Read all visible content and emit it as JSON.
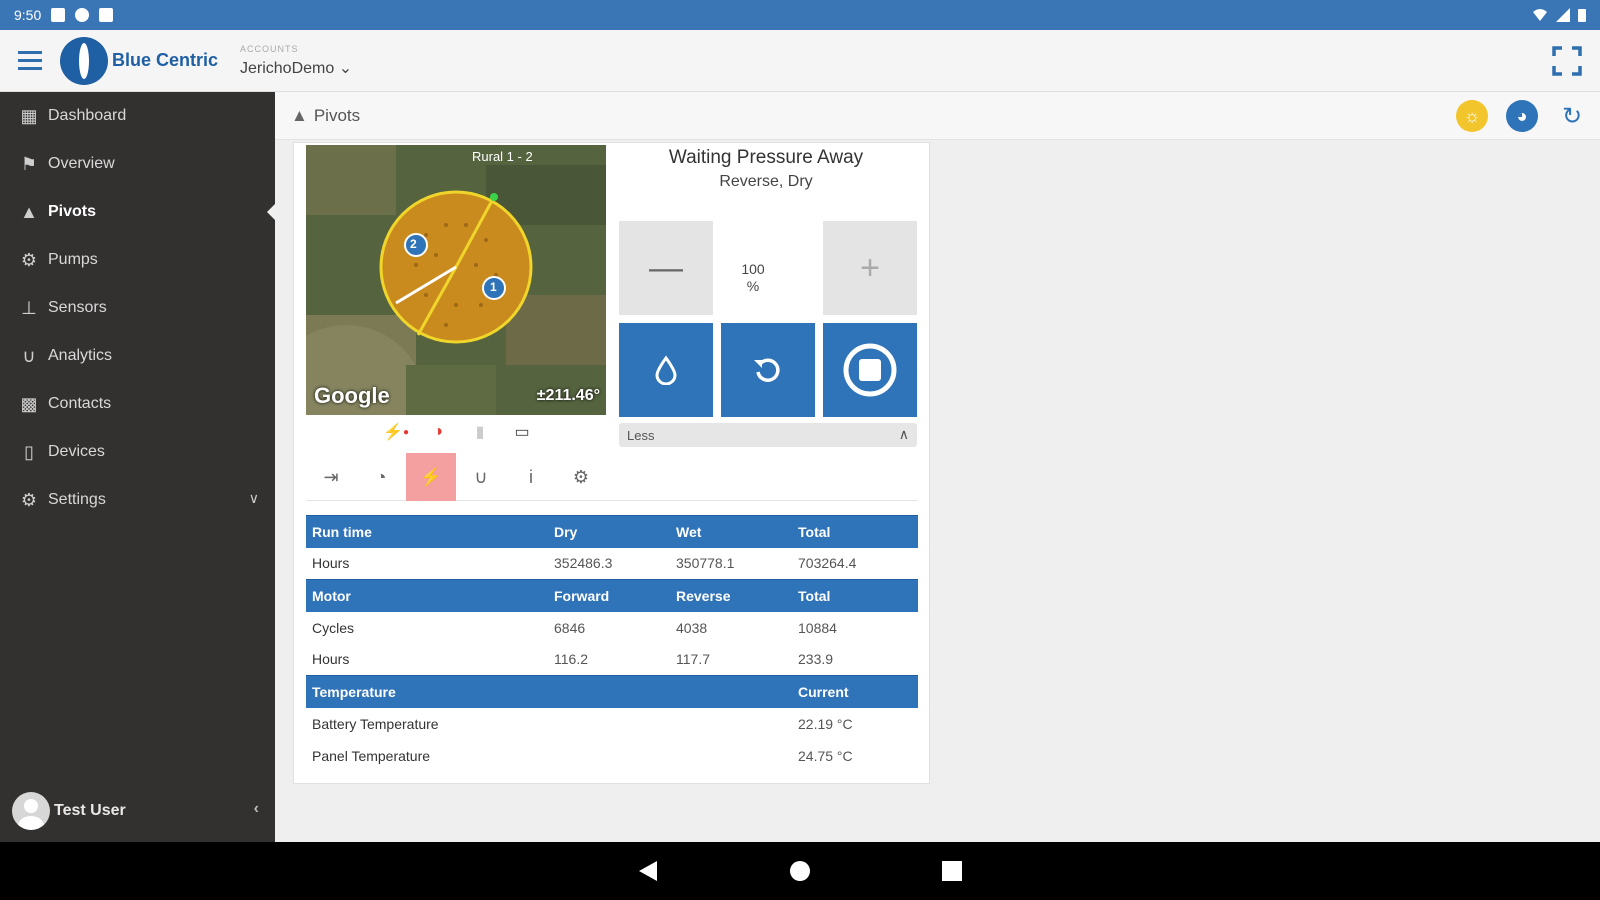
{
  "status_bar": {
    "time": "9:50"
  },
  "app_bar": {
    "brand": "Blue Centric",
    "account_label": "ACCOUNTS",
    "account_value": "JerichoDemo"
  },
  "sidebar": {
    "items": [
      {
        "label": "Dashboard",
        "icon": "dashboard-icon"
      },
      {
        "label": "Overview",
        "icon": "overview-icon"
      },
      {
        "label": "Pivots",
        "icon": "pivot-icon",
        "active": true
      },
      {
        "label": "Pumps",
        "icon": "pump-icon"
      },
      {
        "label": "Sensors",
        "icon": "sensor-icon"
      },
      {
        "label": "Analytics",
        "icon": "analytics-icon"
      },
      {
        "label": "Contacts",
        "icon": "contacts-icon"
      },
      {
        "label": "Devices",
        "icon": "devices-icon"
      },
      {
        "label": "Settings",
        "icon": "gear-icon"
      }
    ],
    "user": "Test User"
  },
  "page": {
    "title": "Pivots"
  },
  "pivot": {
    "map_label": "Rural 1 - 2",
    "map_brand": "Google",
    "angle": "±211.46°",
    "status": "Waiting Pressure Away",
    "direction": "Reverse, Dry",
    "speed": "100",
    "speed_unit": "%",
    "less_label": "Less",
    "zone_labels": [
      "1",
      "2"
    ]
  },
  "tables": {
    "runtime": {
      "headers": [
        "Run time",
        "Dry",
        "Wet",
        "Total"
      ],
      "rows": [
        [
          "Hours",
          "352486.3",
          "350778.1",
          "703264.4"
        ]
      ]
    },
    "motor": {
      "headers": [
        "Motor",
        "Forward",
        "Reverse",
        "Total"
      ],
      "rows": [
        [
          "Cycles",
          "6846",
          "4038",
          "10884"
        ],
        [
          "Hours",
          "116.2",
          "117.7",
          "233.9"
        ]
      ]
    },
    "temperature": {
      "headers": [
        "Temperature",
        "Current"
      ],
      "rows": [
        [
          "Battery Temperature",
          "22.19 °C"
        ],
        [
          "Panel Temperature",
          "24.75 °C"
        ]
      ]
    }
  },
  "colors": {
    "brand_blue": "#2f73b8",
    "status_bar": "#3a76b5",
    "sidebar": "#333130",
    "active_tab": "#f4a0a0"
  }
}
